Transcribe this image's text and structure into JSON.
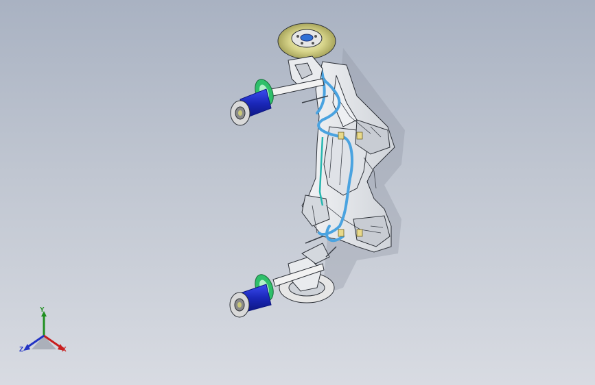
{
  "viewport": {
    "background_top": "#a9b2c2",
    "background_bottom": "#d8dbe2"
  },
  "triad": {
    "x_label": "X",
    "y_label": "Y",
    "z_label": "Z",
    "x_color": "#c81e1e",
    "y_color": "#1f8f1f",
    "z_color": "#2233c4"
  },
  "model": {
    "subject": "rear-suspension-subframe-assembly",
    "colors": {
      "subframe": "#e9ebee",
      "outline": "#2b2f36",
      "brake_line": "#4aa3e0",
      "spring": "#1e2ec8",
      "spring_seat": "#2fbf6a",
      "rotor": "#c9c77a",
      "damper_rod": "#f2f2f2"
    }
  }
}
